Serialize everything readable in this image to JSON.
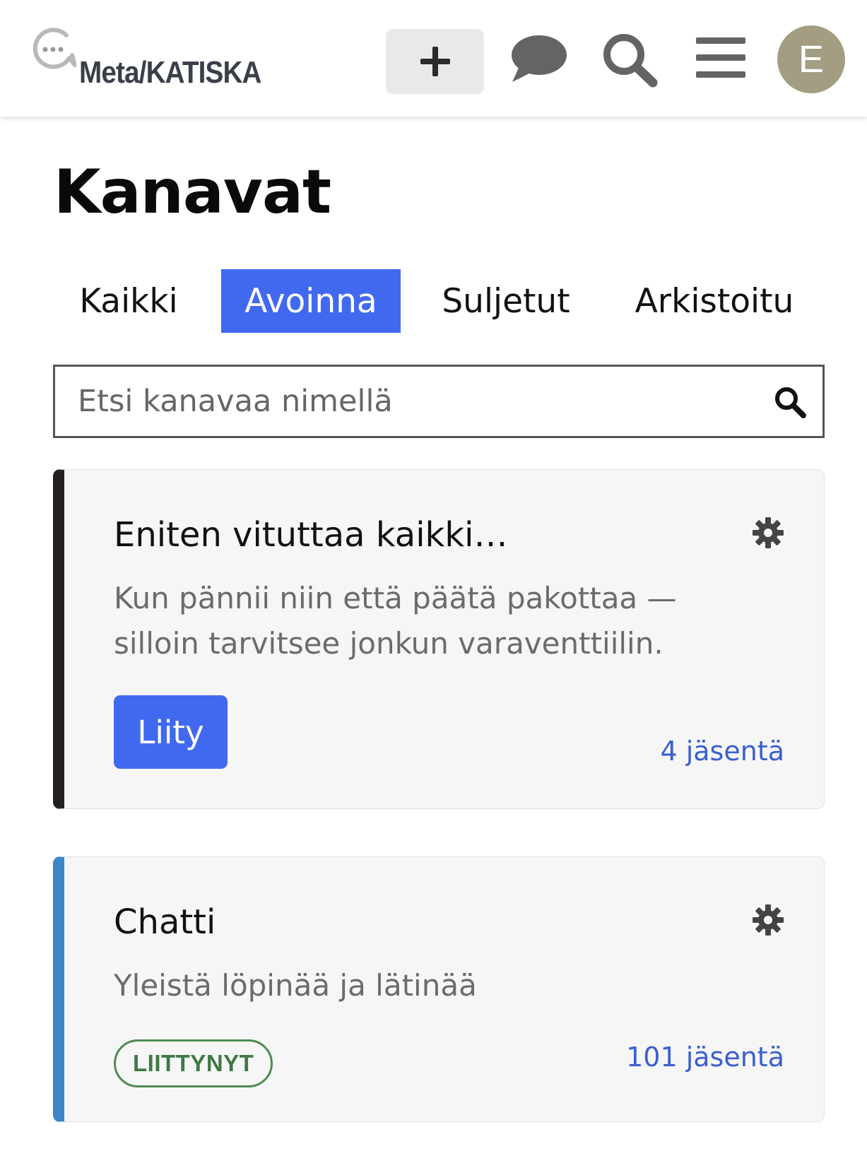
{
  "header": {
    "logo_text": "Meta/KATISKA",
    "avatar_letter": "E"
  },
  "page": {
    "title": "Kanavat"
  },
  "tabs": [
    {
      "label": "Kaikki",
      "active": false
    },
    {
      "label": "Avoinna",
      "active": true
    },
    {
      "label": "Suljetut",
      "active": false
    },
    {
      "label": "Arkistoitu",
      "active": false
    }
  ],
  "search": {
    "placeholder": "Etsi kanavaa nimellä"
  },
  "channels": [
    {
      "title": "Eniten vituttaa kaikki…",
      "description": "Kun pännii niin että päätä pakottaa — silloin tarvitsee jonkun varaventtiilin.",
      "join_label": "Liity",
      "members": "4 jäsentä",
      "accent_color": "#231f20"
    },
    {
      "title": "Chatti",
      "description": "Yleistä löpinää ja lätinää",
      "joined_label": "LIITTYNYT",
      "members": "101 jäsentä",
      "accent_color": "#3c87c8"
    }
  ],
  "colors": {
    "accent": "#4169f0",
    "member_link": "#3a5fd0",
    "joined_green": "#3f7a43",
    "avatar_bg": "#a39e82"
  }
}
